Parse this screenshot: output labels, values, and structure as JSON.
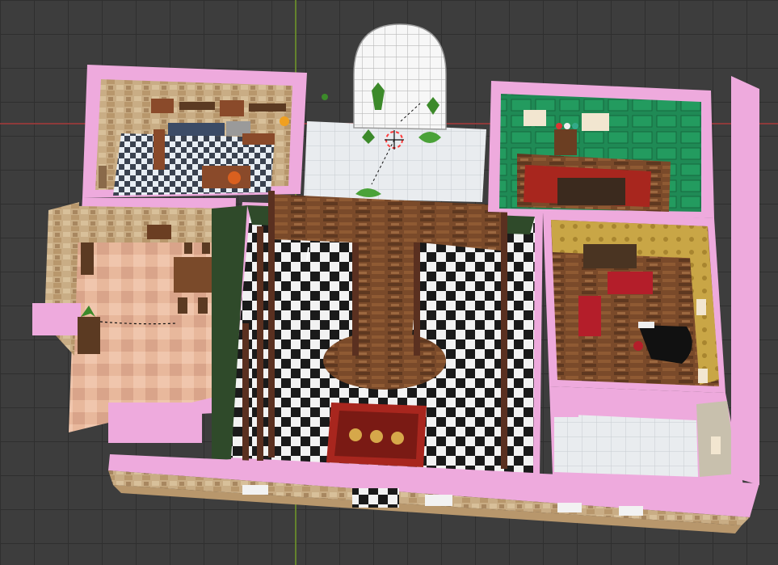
{
  "scene": {
    "viewport": "3d-viewport",
    "colors": {
      "background": "#3d3d3d",
      "grid_line": "#2f2f2f",
      "x_axis": "#9b3a3a",
      "y_axis": "#6b8f2a",
      "wall_top": "#eeaadd",
      "stone": "#c9ad85",
      "checker_dark": "#1a1a1a",
      "checker_light": "#f2f2f2",
      "wood": "#6b3e22",
      "green_wall": "#1f8a55",
      "rug_red": "#a8261e",
      "selection": "#ff3b3b"
    },
    "objects": {
      "house": "house-model",
      "kitchen": "kitchen-room",
      "dining": "dining-room",
      "hall": "central-hall",
      "stairs": "staircase",
      "greenhouse": "greenhouse-dome",
      "study": "study-room",
      "living": "living-room",
      "bath": "bathroom",
      "rug": "hall-rug",
      "piano": "piano",
      "origin": "3d-cursor"
    }
  }
}
